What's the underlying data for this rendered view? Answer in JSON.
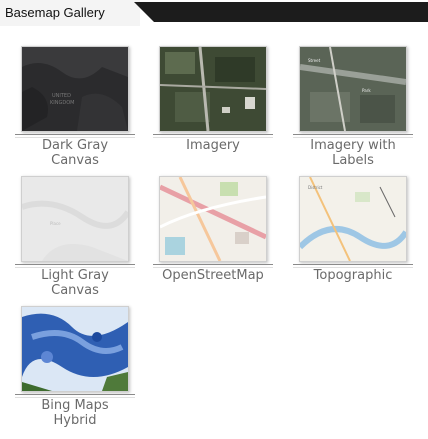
{
  "header": {
    "title": "Basemap Gallery"
  },
  "gallery": {
    "items": [
      {
        "line1": "Dark Gray",
        "line2": "Canvas",
        "thumb": "dark-gray-canvas-thumbnail"
      },
      {
        "line1": "Imagery",
        "line2": "",
        "thumb": "imagery-thumbnail"
      },
      {
        "line1": "Imagery with",
        "line2": "Labels",
        "thumb": "imagery-with-labels-thumbnail"
      },
      {
        "line1": "Light Gray",
        "line2": "Canvas",
        "thumb": "light-gray-canvas-thumbnail"
      },
      {
        "line1": "OpenStreetMap",
        "line2": "",
        "thumb": "openstreetmap-thumbnail"
      },
      {
        "line1": "Topographic",
        "line2": "",
        "thumb": "topographic-thumbnail"
      },
      {
        "line1": "Bing Maps",
        "line2": "Hybrid",
        "thumb": "bing-maps-hybrid-thumbnail"
      }
    ]
  },
  "colors": {
    "header_bar": "#1c1c1c",
    "label_text": "#6a6a6a"
  }
}
